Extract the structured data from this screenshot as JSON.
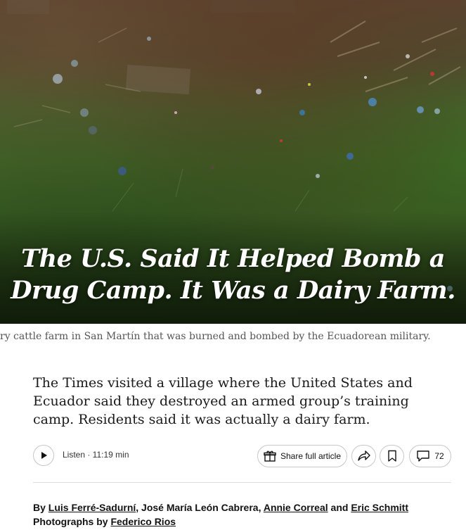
{
  "hero": {
    "headline_line1": "The U.S. Said It Helped Bomb a",
    "headline_line2": "Drug Camp. It Was a Dairy Farm."
  },
  "caption": "ry cattle farm in San Martín that was burned and bombed by the Ecuadorean military.",
  "summary": "The Times visited a village where the United States and Ecuador said they destroyed an armed group’s training camp. Residents said it was actually a dairy farm.",
  "toolbar": {
    "listen_label": "Listen · 11:19 min",
    "share_full_label": "Share full article",
    "comments_count": "72",
    "icons": {
      "play": "play-icon",
      "gift": "gift-icon",
      "share": "share-arrow-icon",
      "bookmark": "bookmark-icon",
      "comment": "comment-icon"
    }
  },
  "byline": {
    "prefix": "By ",
    "authors": [
      {
        "name": "Luis Ferré-Sadurní",
        "linked": true
      },
      {
        "name": "José María León Cabrera",
        "linked": false
      },
      {
        "name": "Annie Correal",
        "linked": true
      },
      {
        "name": "Eric Schmitt",
        "linked": true
      }
    ],
    "sep1": ", ",
    "sep2": ", ",
    "sep3": " and ",
    "photos_prefix": "Photographs by ",
    "photographer": "Federico Rios"
  },
  "colors": {
    "text": "#121212",
    "caption": "#555555",
    "border": "#c7c7c7",
    "rule": "#dfdfdf"
  }
}
